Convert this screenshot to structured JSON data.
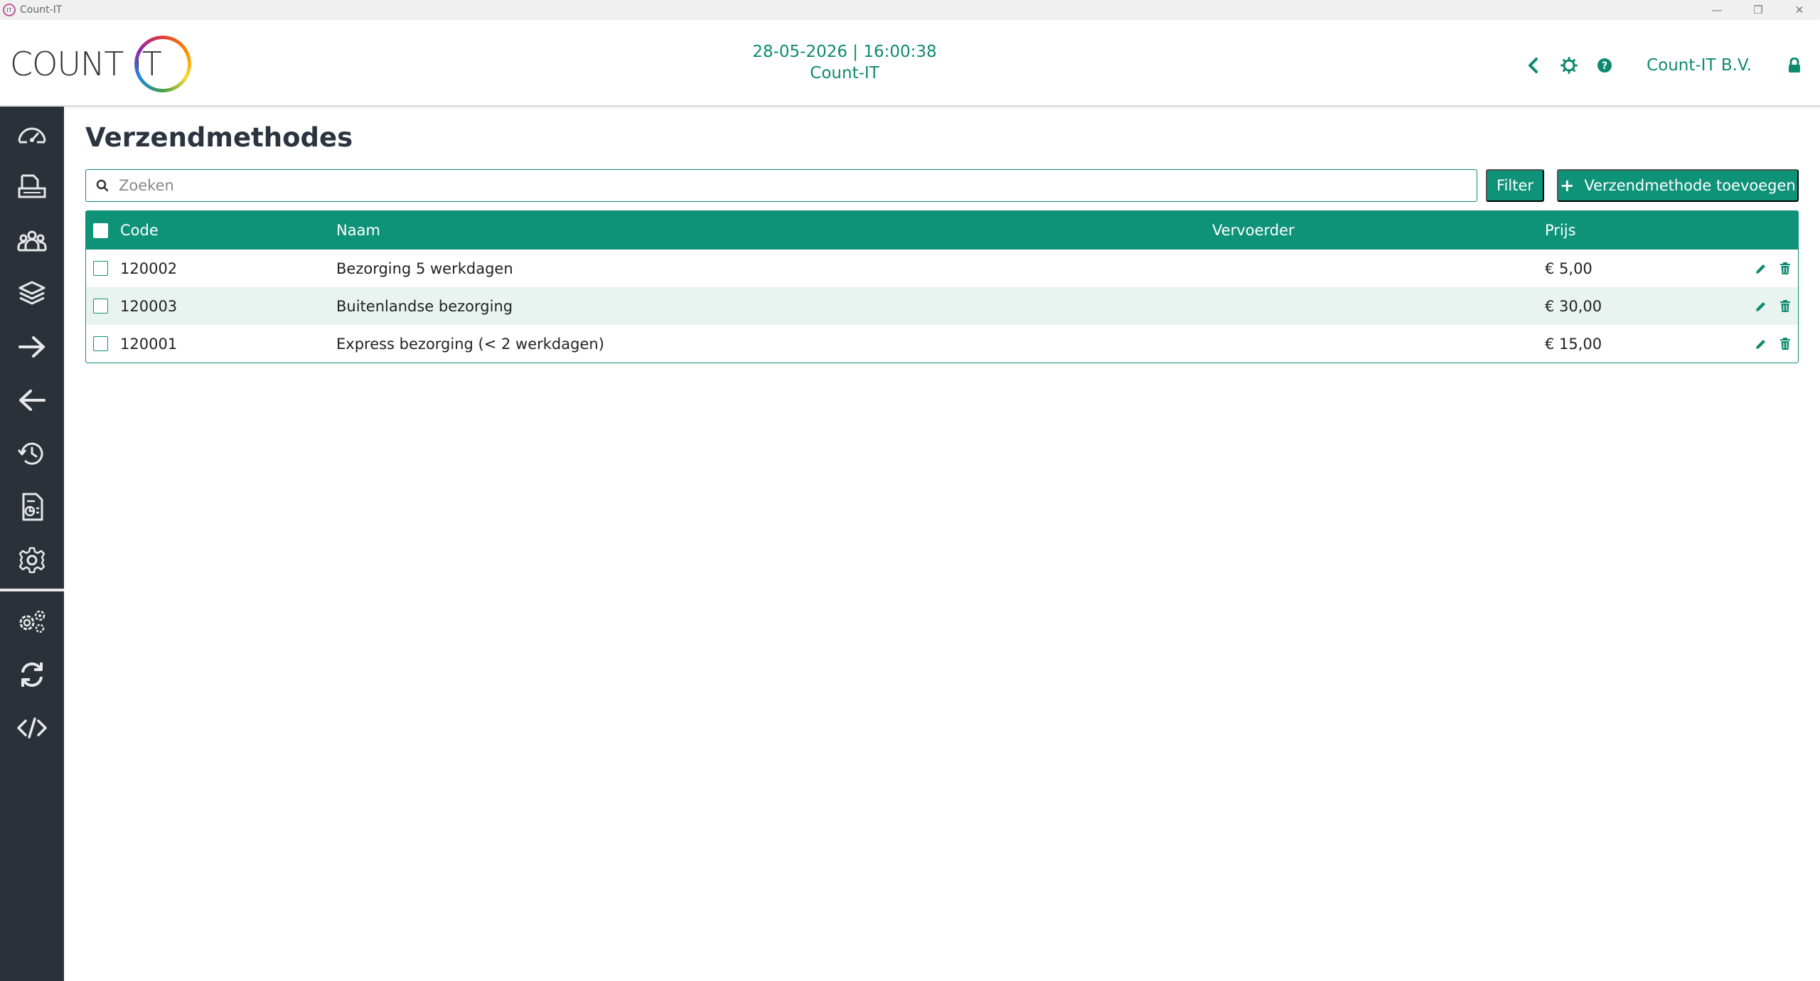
{
  "window": {
    "title": "Count-IT",
    "controls": [
      "minimize",
      "restore",
      "close"
    ]
  },
  "header": {
    "logo_text": "COUNT IT",
    "datetime": "28-05-2026 | 16:00:38",
    "subtitle": "Count-IT",
    "company": "Count-IT B.V.",
    "icons": [
      "chevron-left-icon",
      "settings-cog-icon",
      "help-icon",
      "lock-icon"
    ],
    "accent_color": "#0e8a6e"
  },
  "sidebar": {
    "items": [
      {
        "name": "dashboard",
        "icon": "gauge-icon"
      },
      {
        "name": "invoices",
        "icon": "printer-document-icon"
      },
      {
        "name": "relations",
        "icon": "users-group-icon"
      },
      {
        "name": "products",
        "icon": "box-icon"
      },
      {
        "name": "outgoing",
        "icon": "arrow-right-icon"
      },
      {
        "name": "incoming",
        "icon": "arrow-left-icon"
      },
      {
        "name": "history",
        "icon": "history-icon"
      },
      {
        "name": "reports",
        "icon": "report-icon"
      },
      {
        "name": "settings",
        "icon": "gear-icon"
      },
      {
        "name": "advanced-settings",
        "icon": "gears-icon"
      },
      {
        "name": "sync",
        "icon": "sync-icon"
      },
      {
        "name": "developer",
        "icon": "code-icon"
      }
    ],
    "background": "#2a3138"
  },
  "main": {
    "title": "Verzendmethodes",
    "search": {
      "placeholder": "Zoeken",
      "value": ""
    },
    "filter_label": "Filter",
    "add_label": "Verzendmethode toevoegen",
    "table": {
      "columns": [
        "Code",
        "Naam",
        "Vervoerder",
        "Prijs"
      ],
      "rows": [
        {
          "code": "120002",
          "name": "Bezorging 5 werkdagen",
          "carrier": "",
          "price": "€ 5,00"
        },
        {
          "code": "120003",
          "name": "Buitenlandse bezorging",
          "carrier": "",
          "price": "€ 30,00"
        },
        {
          "code": "120001",
          "name": "Express bezorging (< 2 werkdagen)",
          "carrier": "",
          "price": "€ 15,00"
        }
      ]
    }
  }
}
